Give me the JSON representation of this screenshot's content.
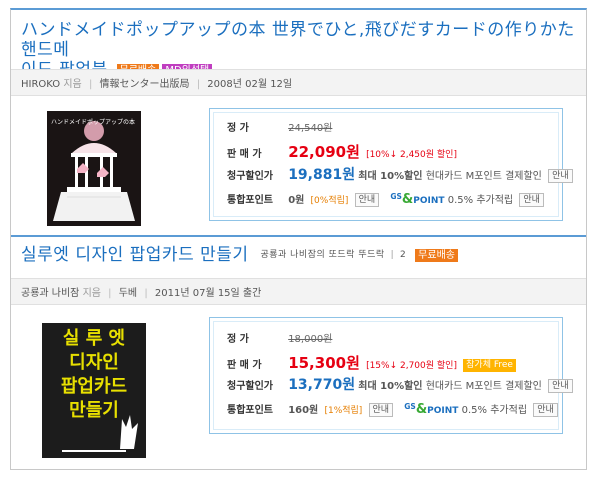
{
  "books": [
    {
      "title": "ハンドメイドポップアップの本 世界でひと,飛びだすカードの作りかた 핸드메이드 팝업북",
      "title_line1": "ハンドメイドポップアップの本 世界でひと,飛びだすカードの作りかた 핸드메",
      "title_line2": "이드 팝업북",
      "badges": [
        "무료배송",
        "MD의선택"
      ],
      "author": "HIROKO",
      "author_role": "지음",
      "publisher": "情報センター出版局",
      "date": "2008년 02월 12일",
      "price": {
        "list_label": "정       가",
        "list_price": "24,540원",
        "sale_label": "판 매 가",
        "sale_price": "22,090원",
        "sale_discount": "[10%↓ 2,450원 할인]",
        "card_label": "청구할인가",
        "card_price": "19,881원",
        "card_note": "최대 10%할인",
        "card_detail": "현대카드 M포인트 결제할인",
        "card_button": "안내",
        "point_label": "통합포인트",
        "point_value": "0원",
        "point_rate": "[0%적립]",
        "point_button": "안내",
        "gs_prefix": "GS",
        "gs_symbol": "&",
        "gs_suffix": "POINT",
        "gs_text": "0.5% 추가적립",
        "gs_button": "안내"
      },
      "cover_title": "ハンドメイドポップアップの本"
    },
    {
      "title": "실루엣 디자인 팝업카드 만들기",
      "subtitle": "공룡과 나비잠의 또드락 뚜드락",
      "subtitle_num": "2",
      "badges": [
        "무료배송"
      ],
      "author": "공룡과 나비잠",
      "author_role": "지음",
      "publisher": "두베",
      "date": "2011년 07월 15일 출간",
      "price": {
        "list_label": "정       가",
        "list_price": "18,000원",
        "sale_label": "판 매 가",
        "sale_price": "15,300원",
        "sale_discount": "[15%↓ 2,700원 할인]",
        "sale_badge": "참가체 Free",
        "card_label": "청구할인가",
        "card_price": "13,770원",
        "card_note": "최대 10%할인",
        "card_detail": "현대카드 M포인트 결제할인",
        "card_button": "안내",
        "point_label": "통합포인트",
        "point_value": "160원",
        "point_rate": "[1%적립]",
        "point_button": "안내",
        "gs_prefix": "GS",
        "gs_symbol": "&",
        "gs_suffix": "POINT",
        "gs_text": "0.5% 추가적립",
        "gs_button": "안내"
      },
      "cover_lines": [
        "실 루 엣",
        "디자인",
        "팝업카드",
        "만들기"
      ]
    }
  ],
  "colors": {
    "title_blue": "#1b6fbf",
    "sale_red": "#e60012",
    "badge_orange": "#ef7a1a",
    "badge_purple": "#c03ec0",
    "box_border": "#8fc3e6",
    "cover2_text": "#e8e000"
  }
}
